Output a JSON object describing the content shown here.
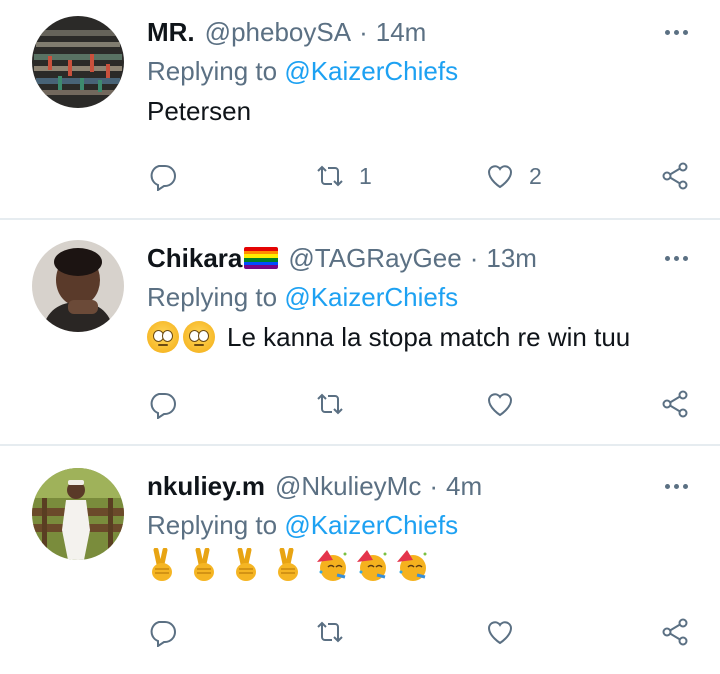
{
  "tweets": [
    {
      "name": "MR.",
      "handle": "@pheboySA",
      "separator": "·",
      "time": "14m",
      "replying_prefix": "Replying to ",
      "replying_to": "@KaizerChiefs",
      "text": "Petersen",
      "retweet_count": "1",
      "like_count": "2"
    },
    {
      "name": "Chikara",
      "name_emoji": "rainbow-flag",
      "handle": "@TAGRayGee",
      "separator": "·",
      "time": "13m",
      "replying_prefix": "Replying to ",
      "replying_to": "@KaizerChiefs",
      "text_emojis": [
        "face-with-rolling-eyes",
        "face-with-rolling-eyes"
      ],
      "text": "Le kanna la stopa match re win tuu",
      "retweet_count": "",
      "like_count": ""
    },
    {
      "name": "nkuliey.m",
      "handle": "@NkulieyMc",
      "separator": "·",
      "time": "4m",
      "replying_prefix": "Replying to ",
      "replying_to": "@KaizerChiefs",
      "text_emojis": [
        "victory-hand",
        "victory-hand",
        "victory-hand",
        "victory-hand",
        "partying-face",
        "partying-face",
        "partying-face"
      ],
      "retweet_count": "",
      "like_count": ""
    }
  ],
  "colors": {
    "text": "#0f1419",
    "secondary": "#5b7083",
    "mention": "#1da1f2",
    "divider": "#e6ecf0"
  }
}
